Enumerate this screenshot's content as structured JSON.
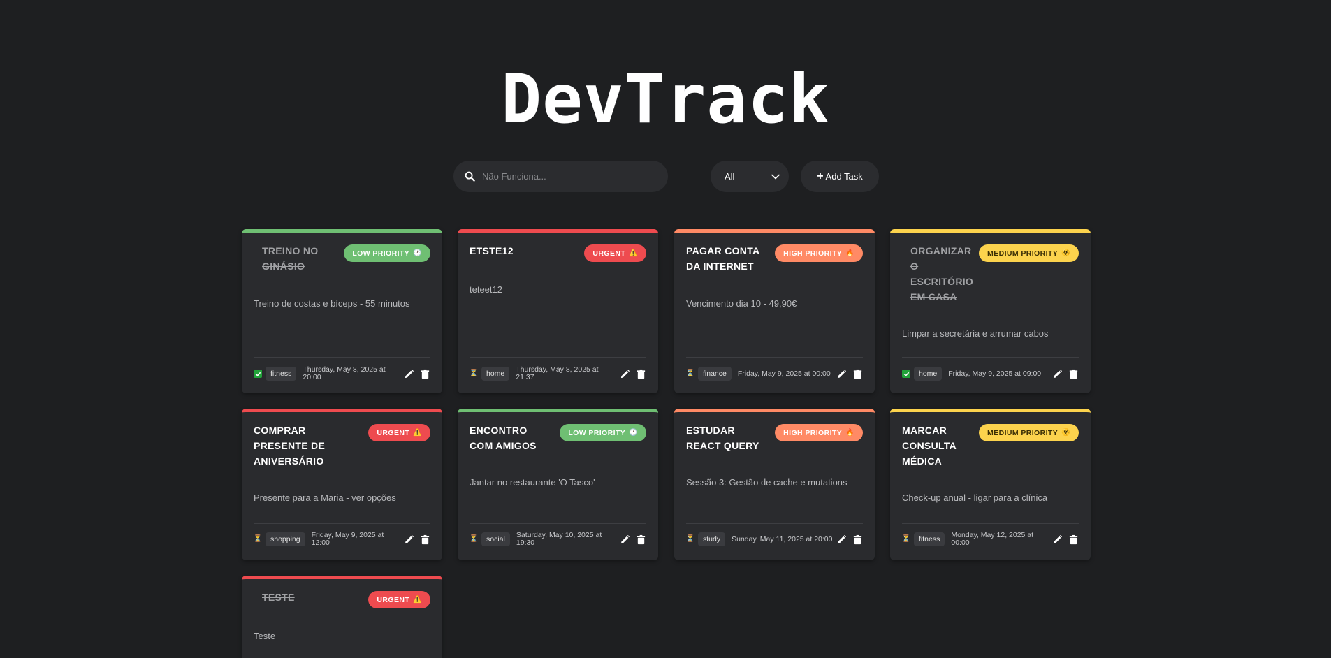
{
  "app": {
    "title": "DevTrack"
  },
  "toolbar": {
    "search_placeholder": "Não Funciona...",
    "filter_value": "All",
    "add_task_label": "Add Task"
  },
  "colors": {
    "low": "#6fbf73",
    "urgent": "#ee4b4f",
    "high": "#ff8a65",
    "medium": "#fcd34d"
  },
  "tasks": [
    {
      "title": "Treino no Ginásio",
      "completed": true,
      "priority": "low",
      "badge": "Low Priority",
      "badge_icon": "clock-icon",
      "description": "Treino de costas e bíceps - 55 minutos",
      "category": "fitness",
      "due": "Thursday, May 8, 2025 at 20:00"
    },
    {
      "title": "etste12",
      "completed": false,
      "priority": "urgent",
      "badge": "Urgent",
      "badge_icon": "warning-icon",
      "description": "teteet12",
      "category": "home",
      "due": "Thursday, May 8, 2025 at 21:37"
    },
    {
      "title": "Pagar conta da internet",
      "completed": false,
      "priority": "high",
      "badge": "High Priority",
      "badge_icon": "fire-icon",
      "description": "Vencimento dia 10 - 49,90€",
      "category": "finance",
      "due": "Friday, May 9, 2025 at 00:00"
    },
    {
      "title": "Organizar o escritório em casa",
      "completed": true,
      "priority": "medium",
      "badge": "Medium Priority",
      "badge_icon": "biohazard-icon",
      "description": "Limpar a secretária e arrumar cabos",
      "category": "home",
      "due": "Friday, May 9, 2025 at 09:00"
    },
    {
      "title": "Comprar presente de aniversário",
      "completed": false,
      "priority": "urgent",
      "badge": "Urgent",
      "badge_icon": "warning-icon",
      "description": "Presente para a Maria - ver opções",
      "category": "shopping",
      "due": "Friday, May 9, 2025 at 12:00"
    },
    {
      "title": "Encontro com amigos",
      "completed": false,
      "priority": "low",
      "badge": "Low Priority",
      "badge_icon": "clock-icon",
      "description": "Jantar no restaurante 'O Tasco'",
      "category": "social",
      "due": "Saturday, May 10, 2025 at 19:30"
    },
    {
      "title": "Estudar React Query",
      "completed": false,
      "priority": "high",
      "badge": "High Priority",
      "badge_icon": "fire-icon",
      "description": "Sessão 3: Gestão de cache e mutations",
      "category": "study",
      "due": "Sunday, May 11, 2025 at 20:00"
    },
    {
      "title": "Marcar consulta médica",
      "completed": false,
      "priority": "medium",
      "badge": "Medium Priority",
      "badge_icon": "biohazard-icon",
      "description": "Check-up anual - ligar para a clínica",
      "category": "fitness",
      "due": "Monday, May 12, 2025 at 00:00"
    },
    {
      "title": "Teste",
      "completed": true,
      "priority": "urgent",
      "badge": "Urgent",
      "badge_icon": "warning-icon",
      "description": "Teste",
      "category": "",
      "due": ""
    }
  ]
}
